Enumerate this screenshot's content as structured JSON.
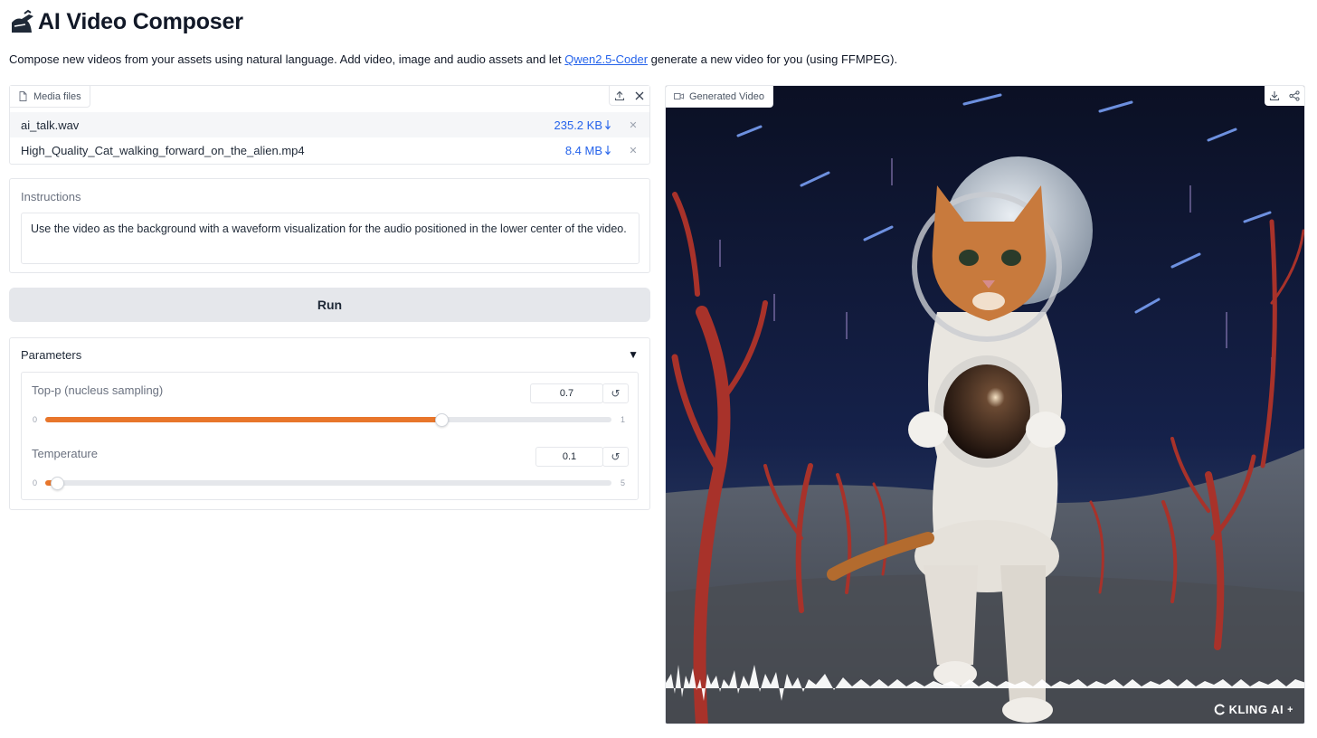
{
  "app": {
    "title": "AI Video Composer",
    "subtitle_before": "Compose new videos from your assets using natural language. Add video, image and audio assets and let ",
    "subtitle_link": "Qwen2.5-Coder",
    "subtitle_after": " generate a new video for you (using FFMPEG)."
  },
  "media": {
    "label": "Media files",
    "files": [
      {
        "name": "ai_talk.wav",
        "size": "235.2 KB"
      },
      {
        "name": "High_Quality_Cat_walking_forward_on_the_alien.mp4",
        "size": "8.4 MB"
      }
    ]
  },
  "instructions": {
    "label": "Instructions",
    "value": "Use the video as the background with a waveform visualization for the audio positioned in the lower center of the video."
  },
  "run_label": "Run",
  "parameters": {
    "label": "Parameters",
    "top_p": {
      "label": "Top-p (nucleus sampling)",
      "value": "0.7",
      "min": "0",
      "max": "1",
      "fraction": 0.7
    },
    "temperature": {
      "label": "Temperature",
      "value": "0.1",
      "min": "0",
      "max": "5",
      "fraction": 0.02
    }
  },
  "output": {
    "label": "Generated Video",
    "watermark": "KLING AI",
    "watermark_sup": "+"
  },
  "colors": {
    "accent": "#e8762b",
    "link": "#2563eb"
  }
}
